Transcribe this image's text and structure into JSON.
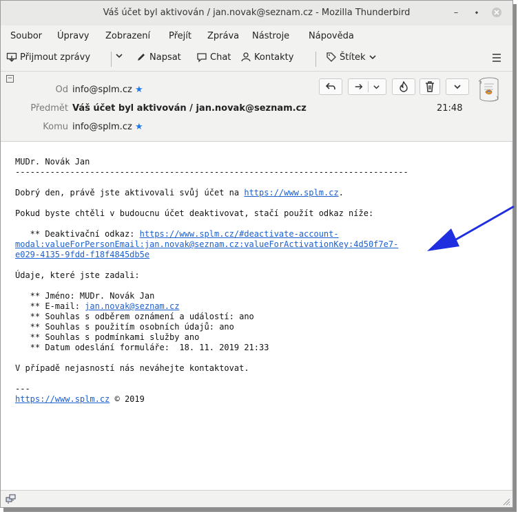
{
  "window": {
    "title": "Váš účet byl aktivován / jan.novak@seznam.cz - Mozilla Thunderbird"
  },
  "menu": [
    "Soubor",
    "Úpravy",
    "Zobrazení",
    "Přejít",
    "Zpráva",
    "Nástroje",
    "Nápověda"
  ],
  "toolbar": {
    "get_messages": "Přijmout zprávy",
    "write": "Napsat",
    "chat": "Chat",
    "contacts": "Kontakty",
    "tag": "Štítek"
  },
  "header": {
    "from_label": "Od",
    "from_value": "info@splm.cz",
    "subject_label": "Předmět",
    "subject_value": "Váš účet byl aktivován / jan.novak@seznam.cz",
    "time": "21:48",
    "to_label": "Komu",
    "to_value": "info@splm.cz"
  },
  "body": {
    "name": "MUDr. Novák Jan",
    "divider": "-------------------------------------------------------------------------------",
    "greeting_prefix": "Dobrý den, právě jste aktivovali svůj účet na ",
    "site_link": "https://www.splm.cz",
    "greeting_suffix": ".",
    "deactivate_line": "Pokud byste chtěli v budoucnu účet deaktivovat, stačí použít odkaz níže:",
    "deactivate_prefix": "   ** Deaktivační odkaz: ",
    "deactivate_link_1": "https://www.splm.cz/#deactivate-account-",
    "deactivate_link_2": "modal:valueForPersonEmail:jan.novak@seznam.cz:valueForActivationKey:4d50f7e7-",
    "deactivate_link_3": "e029-4135-9fdd-f18f4845db5e",
    "entered_heading": "Údaje, které jste zadali:",
    "name_line": "   ** Jméno: MUDr. Novák Jan",
    "email_prefix": "   ** E-mail: ",
    "email_link": "jan.novak@seznam.cz",
    "consent_1": "   ** Souhlas s odběrem oznámení a událostí: ano",
    "consent_2": "   ** Souhlas s použitím osobních údajů: ano",
    "consent_3": "   ** Souhlas s podmínkami služby ano",
    "date_line": "   ** Datum odeslání formuláře:  18. 11. 2019 21:33",
    "contact_line": "V případě nejasností nás neváhejte kontaktovat.",
    "sig_sep": "---",
    "footer_link": "https://www.splm.cz",
    "footer_suffix": " © 2019"
  },
  "annotation": {
    "arrow_color": "#1f2fe0"
  }
}
